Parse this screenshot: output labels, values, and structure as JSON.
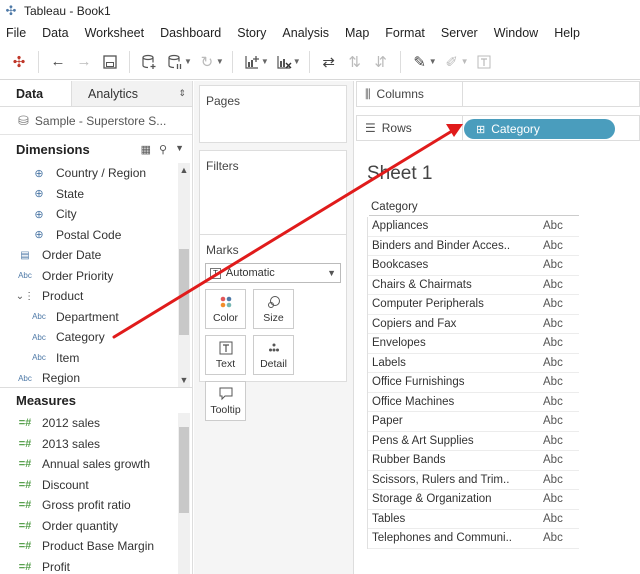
{
  "app": {
    "title": "Tableau - Book1"
  },
  "menu": [
    "File",
    "Data",
    "Worksheet",
    "Dashboard",
    "Story",
    "Analysis",
    "Map",
    "Format",
    "Server",
    "Window",
    "Help"
  ],
  "toolbar_icons": [
    "tableau-logo-icon",
    "back-icon",
    "forward-icon",
    "save-icon",
    "new-datasource-icon",
    "pause-updates-icon",
    "refresh-icon",
    "new-worksheet-icon",
    "clear-sheet-icon",
    "swap-icon",
    "sort-ascending-icon",
    "sort-descending-icon",
    "highlight-icon",
    "attach-icon",
    "text-label-icon"
  ],
  "data_pane": {
    "tab_data": "Data",
    "tab_analytics": "Analytics",
    "datasource": "Sample - Superstore S...",
    "dimensions_title": "Dimensions",
    "dimensions": [
      {
        "label": "Country / Region",
        "icon": "globe-icon",
        "indent": 2
      },
      {
        "label": "State",
        "icon": "globe-icon",
        "indent": 2
      },
      {
        "label": "City",
        "icon": "globe-icon",
        "indent": 2
      },
      {
        "label": "Postal Code",
        "icon": "globe-icon",
        "indent": 2
      },
      {
        "label": "Order Date",
        "icon": "calendar-icon",
        "indent": 1
      },
      {
        "label": "Order Priority",
        "icon": "abc-icon",
        "indent": 1
      },
      {
        "label": "Product",
        "icon": "hierarchy-icon",
        "indent": 1
      },
      {
        "label": "Department",
        "icon": "abc-icon",
        "indent": 2
      },
      {
        "label": "Category",
        "icon": "abc-icon",
        "indent": 2
      },
      {
        "label": "Item",
        "icon": "abc-icon",
        "indent": 2
      },
      {
        "label": "Region",
        "icon": "abc-icon",
        "indent": 1
      }
    ],
    "measures_title": "Measures",
    "measures": [
      "2012 sales",
      "2013 sales",
      "Annual sales growth",
      "Discount",
      "Gross profit ratio",
      "Order quantity",
      "Product Base Margin",
      "Profit"
    ]
  },
  "shelves": {
    "pages": "Pages",
    "filters": "Filters",
    "marks": "Marks",
    "marks_type": "Automatic",
    "mark_buttons": [
      {
        "label": "Color",
        "icon": "color-icon"
      },
      {
        "label": "Size",
        "icon": "size-icon"
      },
      {
        "label": "Text",
        "icon": "text-icon"
      },
      {
        "label": "Detail",
        "icon": "detail-icon"
      },
      {
        "label": "Tooltip",
        "icon": "tooltip-icon"
      }
    ],
    "columns": "Columns",
    "rows": "Rows",
    "rows_pill": "Category"
  },
  "sheet": {
    "title": "Sheet 1",
    "header": "Category",
    "rows": [
      "Appliances",
      "Binders and Binder Acces..",
      "Bookcases",
      "Chairs & Chairmats",
      "Computer Peripherals",
      "Copiers and Fax",
      "Envelopes",
      "Labels",
      "Office Furnishings",
      "Office Machines",
      "Paper",
      "Pens & Art Supplies",
      "Rubber Bands",
      "Scissors, Rulers and Trim..",
      "Storage & Organization",
      "Tables",
      "Telephones and Communi.."
    ],
    "cell_value": "Abc"
  },
  "colors": {
    "pill": "#4a9dbd",
    "arrow": "#e01b1b",
    "measure": "#59a14f",
    "dimension": "#4e79a7"
  }
}
